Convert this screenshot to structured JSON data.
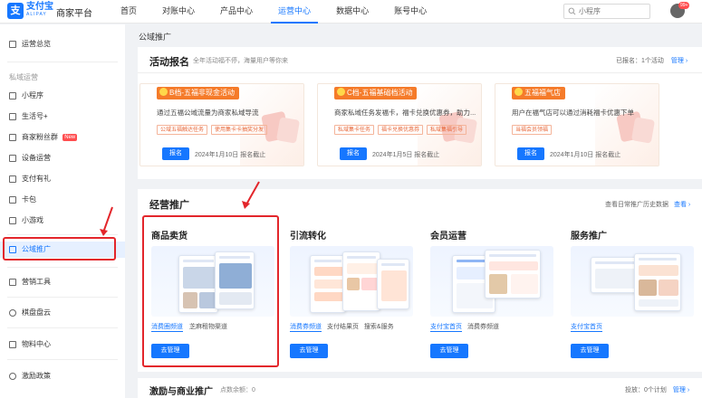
{
  "header": {
    "logo_cn": "支付宝",
    "logo_en": "ALIPAY",
    "platform": "商家平台",
    "nav": [
      "首页",
      "对账中心",
      "产品中心",
      "运营中心",
      "数据中心",
      "账号中心"
    ],
    "active_nav": 3,
    "search_placeholder": "小程序",
    "bell_badge": "99+"
  },
  "sidebar": {
    "overview": "运营总览",
    "group_private": "私域运营",
    "items": [
      {
        "label": "小程序"
      },
      {
        "label": "生活号+"
      },
      {
        "label": "商家粉丝群",
        "badge": "New"
      },
      {
        "label": "设备运营"
      },
      {
        "label": "支付有礼"
      },
      {
        "label": "卡包"
      },
      {
        "label": "小游戏"
      }
    ],
    "public": "公域推广",
    "marketing": "营销工具",
    "inventory": "棋盘盘云",
    "materials": "物料中心",
    "incentive": "激励政策"
  },
  "breadcrumb": "公域推广",
  "activity": {
    "title": "活动报名",
    "subtitle": "全年活动福不停，海量用户等你来",
    "right_text": "已报名：1个活动",
    "manage": "管理",
    "cards": [
      {
        "tag": "B档-五福非现金活动",
        "desc": "通过五福公域流量为商家私域导流",
        "chips": [
          "公域五福触达任务",
          "使用集卡卡抽奖分发",
          ""
        ],
        "button": "报名",
        "date": "2024年1月10日 报名截止"
      },
      {
        "tag": "C档-五福基础档活动",
        "desc": "商家私域任务发福卡，福卡兑换优惠券，助力...",
        "chips": [
          "私域集卡任务",
          "福卡兑换优惠券",
          "私域集福引导"
        ],
        "button": "报名",
        "date": "2024年1月5日 报名截止"
      },
      {
        "tag": "五福福气店",
        "desc": "用户在福气店可以通过消耗福卡优惠下单",
        "chips": [
          "当福会员领福"
        ],
        "button": "报名",
        "date": "2024年1月10日 报名截止"
      }
    ]
  },
  "business": {
    "title": "经营推广",
    "right_text": "查看日常推广历史数据",
    "right_link": "查看",
    "cards": [
      {
        "title": "商品卖货",
        "tabs": [
          "消费圈频道",
          "芝麻租物渠道"
        ],
        "button": "去管理"
      },
      {
        "title": "引流转化",
        "tabs": [
          "消费券频道",
          "支付结果页",
          "搜索&服务"
        ],
        "button": "去管理"
      },
      {
        "title": "会员运营",
        "tabs": [
          "支付宝首页",
          "消费券频道"
        ],
        "button": "去管理"
      },
      {
        "title": "服务推广",
        "tabs": [
          "支付宝首页"
        ],
        "button": "去管理"
      }
    ]
  },
  "incentive": {
    "title": "激励与商业推广",
    "subtitle": "点数余额：0",
    "right_text": "投放：0个计划",
    "manage": "管理"
  },
  "colors": {
    "primary": "#1677ff",
    "tag_orange": "#f57b2a",
    "annotation_red": "#e3262b"
  }
}
